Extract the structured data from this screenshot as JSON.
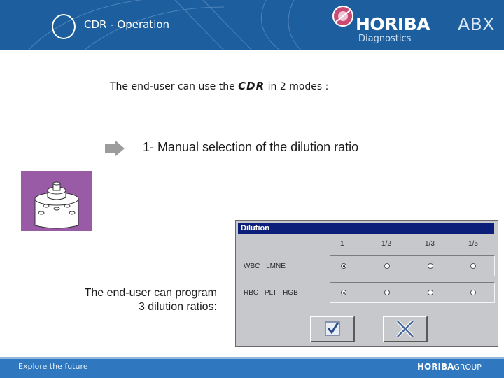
{
  "header": {
    "title": "CDR - Operation",
    "logo": {
      "word": "HORIBA",
      "suffix": "ABX",
      "subtitle": "Diagnostics"
    }
  },
  "intro": {
    "prefix": "The end-user can use the",
    "product": "CDR",
    "suffix": "in 2 modes :"
  },
  "mode_1": "1- Manual selection of the dilution ratio",
  "program_note": {
    "line1": "The end-user can program",
    "line2": "3 dilution ratios:"
  },
  "dialog": {
    "title": "Dilution",
    "columns": [
      "1",
      "1/2",
      "1/3",
      "1/5"
    ],
    "rows": [
      {
        "label": "WBC LMNE",
        "selected": "1"
      },
      {
        "label": "RBC PLT HGB",
        "selected": "1"
      }
    ],
    "ok_icon": "checkmark-icon",
    "cancel_icon": "cross-icon"
  },
  "footer": {
    "tagline": "Explore the future",
    "logo_bold": "HORIBA",
    "logo_thin": "GROUP"
  },
  "colors": {
    "header_blue": "#1d5f9e",
    "footer_blue": "#2f77be",
    "device_purple": "#9a5ba6",
    "dialog_title": "#0a1e7a",
    "dialog_bg": "#c6c8cc"
  }
}
